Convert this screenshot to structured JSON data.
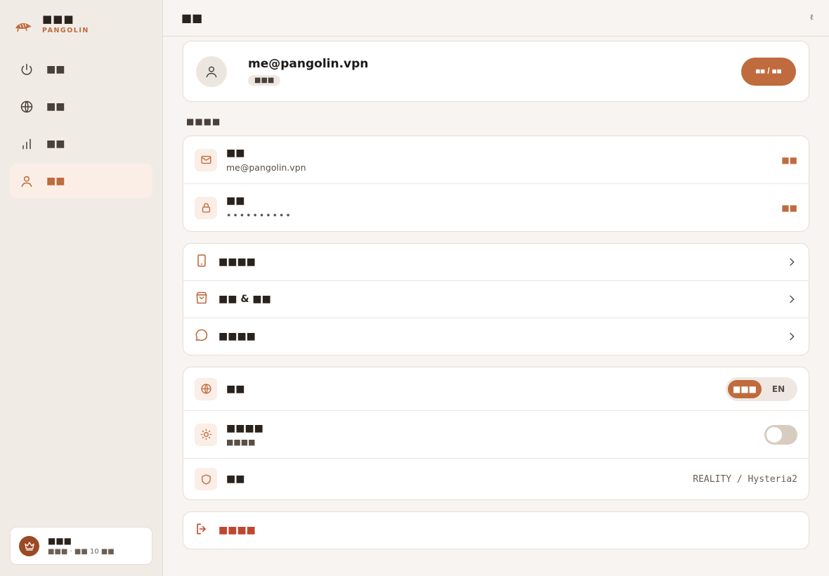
{
  "brand": {
    "name": "■■■",
    "subtitle": "PANGOLIN"
  },
  "nav": {
    "items": [
      {
        "label": "■■",
        "icon": "power-icon"
      },
      {
        "label": "■■",
        "icon": "globe-icon"
      },
      {
        "label": "■■",
        "icon": "bar-chart-icon"
      },
      {
        "label": "■■",
        "icon": "user-icon",
        "active": true
      }
    ]
  },
  "plan": {
    "title": "■■■",
    "subtitle": "■■■ · ■■ 10 ■■",
    "icon": "crown-icon"
  },
  "topbar": {
    "title": "■■",
    "meta": "ℓ"
  },
  "profile": {
    "email": "me@pangolin.vpn",
    "tier": "■■■",
    "button_label": "■■ / ■■"
  },
  "account_section": {
    "label": "■■■■",
    "email_row": {
      "label": "■■",
      "value": "me@pangolin.vpn",
      "action": "■■",
      "icon": "mail-icon"
    },
    "password_row": {
      "label": "■■",
      "value": "••••••••••",
      "action": "■■",
      "icon": "lock-icon"
    }
  },
  "links": [
    {
      "label": "■■■■",
      "icon": "phone-icon"
    },
    {
      "label": "■■ & ■■",
      "icon": "bag-icon"
    },
    {
      "label": "■■■■",
      "icon": "chat-icon"
    }
  ],
  "settings": {
    "language": {
      "label": "■■",
      "options": [
        "■■■",
        "EN"
      ],
      "selected": "■■■",
      "icon": "globe-icon"
    },
    "theme": {
      "label": "■■■■",
      "sub": "■■■■",
      "enabled": false,
      "icon": "sun-icon"
    },
    "protocol": {
      "label": "■■",
      "value": "REALITY / Hysteria2",
      "icon": "shield-icon"
    }
  },
  "logout": {
    "label": "■■■■",
    "icon": "logout-icon"
  },
  "colors": {
    "accent": "#bf6b3d",
    "danger": "#c0472e",
    "sidebar_bg": "#f1ebe6",
    "page_bg": "#f7f4f1"
  }
}
